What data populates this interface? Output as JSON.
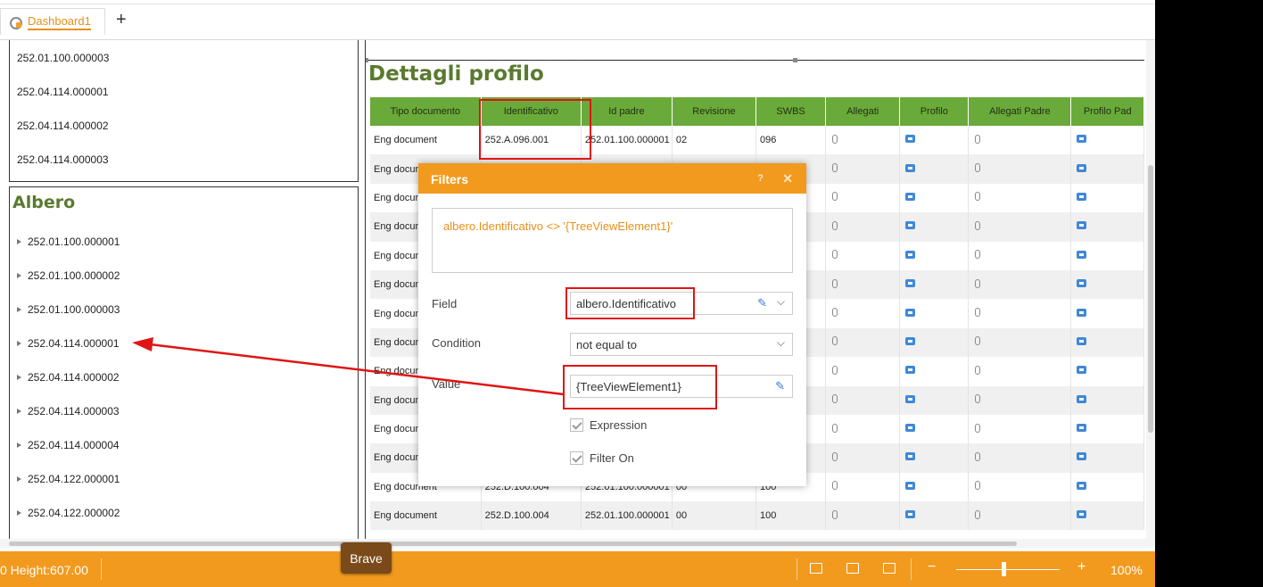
{
  "tabs": {
    "active_label": "Dashboard1",
    "add_label": "+"
  },
  "left_list": {
    "items": [
      "252.01.100.000003",
      "252.04.114.000001",
      "252.04.114.000002",
      "252.04.114.000003"
    ]
  },
  "tree": {
    "title": "Albero",
    "nodes": [
      "252.01.100.000001",
      "252.01.100.000002",
      "252.01.100.000003",
      "252.04.114.000001",
      "252.04.114.000002",
      "252.04.114.000003",
      "252.04.114.000004",
      "252.04.122.000001",
      "252.04.122.000002"
    ]
  },
  "details": {
    "title": "Dettagli profilo",
    "columns": [
      "Tipo documento",
      "Identificativo",
      "Id padre",
      "Revisione",
      "SWBS",
      "Allegati",
      "Profilo",
      "Allegati Padre",
      "Profilo Pad"
    ],
    "rows": [
      [
        "Eng document",
        "252.A.096.001",
        "252.01.100.000001",
        "02",
        "096"
      ],
      [
        "Eng docum",
        "",
        "",
        "",
        ""
      ],
      [
        "Eng docum",
        "",
        "",
        "",
        ""
      ],
      [
        "Eng docum",
        "",
        "",
        "",
        ""
      ],
      [
        "Eng docum",
        "",
        "",
        "",
        ""
      ],
      [
        "Eng docum",
        "",
        "",
        "",
        ""
      ],
      [
        "Eng docum",
        "",
        "",
        "",
        ""
      ],
      [
        "Eng docum",
        "",
        "",
        "",
        ""
      ],
      [
        "Eng docum",
        "",
        "",
        "",
        ""
      ],
      [
        "Eng docum",
        "",
        "",
        "",
        ""
      ],
      [
        "Eng docum",
        "",
        "",
        "",
        ""
      ],
      [
        "Eng docum",
        "",
        "",
        "",
        ""
      ],
      [
        "Eng document",
        "252.D.100.004",
        "252.01.100.000001",
        "00",
        "100"
      ],
      [
        "Eng document",
        "252.D.100.004",
        "252.01.100.000001",
        "00",
        "100"
      ]
    ]
  },
  "filters_dialog": {
    "title": "Filters",
    "help": "?",
    "close": "✕",
    "expression": "albero.Identificativo <> '{TreeViewElement1}'",
    "field_label": "Field",
    "field_value": "albero.Identificativo",
    "condition_label": "Condition",
    "condition_value": "not equal to",
    "value_label": "Value",
    "value_value": "{TreeViewElement1}",
    "expression_checkbox": "Expression",
    "filter_on_checkbox": "Filter On"
  },
  "status_bar": {
    "height_text": "0 Height:607.00",
    "zoom": "100%",
    "minus": "−",
    "plus": "+"
  },
  "tooltip": {
    "label": "Brave"
  },
  "colors": {
    "accent": "#f29a1e",
    "header_green": "#6aaa3a",
    "title_green": "#5a7a2f",
    "highlight_red": "#e01414"
  }
}
